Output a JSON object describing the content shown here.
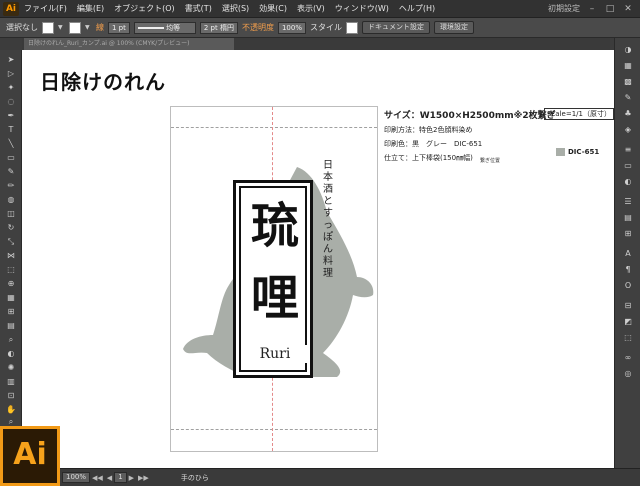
{
  "app": {
    "logo": "Ai",
    "menu": [
      "ファイル(F)",
      "編集(E)",
      "オブジェクト(O)",
      "書式(T)",
      "選択(S)",
      "効果(C)",
      "表示(V)",
      "ウィンドウ(W)",
      "ヘルプ(H)"
    ],
    "workspace": "初期設定"
  },
  "controlbar": {
    "selection": "選択なし",
    "stroke_label": "線",
    "stroke_value": "1 pt",
    "stroke_style": "均等",
    "brush": "2 pt 楕円",
    "opacity_label": "不透明度",
    "opacity_value": "100%",
    "style_label": "スタイル",
    "doc_settings": "ドキュメント設定",
    "env_settings": "環境設定"
  },
  "doc_tab": {
    "name": "日除けのれん_Ruri_カンプ.ai @ 100% (CMYK/プレビュー)"
  },
  "artwork": {
    "title": "日除けのれん",
    "brand_kanji": [
      "琉",
      "哩"
    ],
    "romaji": "Ruri",
    "subtitle_vertical": "日本酒とすっぽん料理",
    "size": "サイズ：W1500×H2500mm※2枚繋ぎ",
    "scale": "Scale=1/1（原寸）",
    "print_method": "印刷方法：特色2色顔料染め",
    "print_colors": "印刷色：黒　グレー　DIC-651",
    "finishing": "仕立て：上下棒袋(150㎜幅)",
    "seam_note": "繋ぎ位置",
    "swatch_color": "#a9aea8",
    "swatch_label": "DIC-651"
  },
  "status": {
    "zoom": "100%",
    "page": "1",
    "tool": "手のひら"
  }
}
